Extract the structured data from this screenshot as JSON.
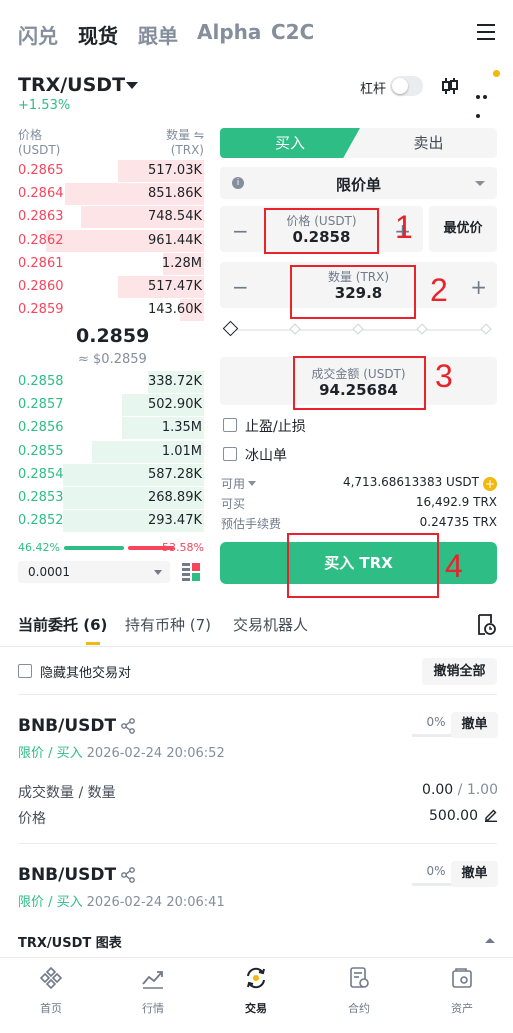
{
  "top_nav": {
    "tabs": [
      "闪兑",
      "现货",
      "跟单",
      "Alpha",
      "C2C"
    ],
    "active": "现货"
  },
  "pair": {
    "name": "TRX/USDT",
    "change": "+1.53%",
    "leverage_label": "杠杆"
  },
  "orderbook": {
    "price_header": "价格",
    "price_unit": "(USDT)",
    "qty_header": "数量 ⇋",
    "qty_unit": "(TRX)",
    "asks": [
      {
        "price": "0.2865",
        "qty": "517.03K",
        "depth": 0.46
      },
      {
        "price": "0.2864",
        "qty": "851.86K",
        "depth": 0.75
      },
      {
        "price": "0.2863",
        "qty": "748.54K",
        "depth": 0.66
      },
      {
        "price": "0.2862",
        "qty": "961.44K",
        "depth": 0.85
      },
      {
        "price": "0.2861",
        "qty": "1.28M",
        "depth": 0.22
      },
      {
        "price": "0.2860",
        "qty": "517.47K",
        "depth": 0.46
      },
      {
        "price": "0.2859",
        "qty": "143.60K",
        "depth": 0.13
      }
    ],
    "mid_price": "0.2859",
    "mid_fiat": "≈ $0.2859",
    "bids": [
      {
        "price": "0.2858",
        "qty": "338.72K",
        "depth": 0.3
      },
      {
        "price": "0.2857",
        "qty": "502.90K",
        "depth": 0.44
      },
      {
        "price": "0.2856",
        "qty": "1.35M",
        "depth": 0.44
      },
      {
        "price": "0.2855",
        "qty": "1.01M",
        "depth": 0.6
      },
      {
        "price": "0.2854",
        "qty": "587.28K",
        "depth": 0.76
      },
      {
        "price": "0.2853",
        "qty": "268.89K",
        "depth": 0.76
      },
      {
        "price": "0.2852",
        "qty": "293.47K",
        "depth": 0.76
      }
    ],
    "buy_ratio": "46.42%",
    "sell_ratio": "53.58%",
    "precision": "0.0001"
  },
  "trade_form": {
    "buy_tab": "买入",
    "sell_tab": "卖出",
    "order_type": "限价单",
    "price_label": "价格 (USDT)",
    "price_value": "0.2858",
    "best_price_btn": "最优价",
    "qty_label": "数量 (TRX)",
    "qty_value": "329.8",
    "total_label": "成交金额 (USDT)",
    "total_value": "94.25684",
    "tpsl_label": "止盈/止损",
    "iceberg_label": "冰山单",
    "available_label": "可用",
    "available_value": "4,713.68613383 USDT",
    "can_buy_label": "可买",
    "can_buy_value": "16,492.9 TRX",
    "fee_label": "预估手续费",
    "fee_value": "0.24735 TRX",
    "submit_label": "买入 TRX"
  },
  "annotations": {
    "marks": [
      "1",
      "2",
      "3",
      "4"
    ],
    "color": "#e8232b"
  },
  "orders": {
    "tabs": [
      "当前委托 (6)",
      "持有币种 (7)",
      "交易机器人"
    ],
    "hide_others_label": "隐藏其他交易对",
    "cancel_all_label": "撤销全部",
    "items": [
      {
        "symbol": "BNB/USDT",
        "type": "限价 / 买入",
        "time": "2026-02-24 20:06:52",
        "fill_pct": "0%",
        "cancel_label": "撤单",
        "qty_label": "成交数量 / 数量",
        "qty_filled": "0.00",
        "qty_sep": " / ",
        "qty_total": "1.00",
        "price_label": "价格",
        "price_value": "500.00"
      },
      {
        "symbol": "BNB/USDT",
        "type": "限价 / 买入",
        "time": "2026-02-24 20:06:41",
        "fill_pct": "0%",
        "cancel_label": "撤单"
      }
    ]
  },
  "chart_toggle_label": "TRX/USDT 图表",
  "bottom_nav": [
    {
      "label": "首页",
      "icon": "home-icon"
    },
    {
      "label": "行情",
      "icon": "markets-icon"
    },
    {
      "label": "交易",
      "icon": "trade-icon"
    },
    {
      "label": "合约",
      "icon": "futures-icon"
    },
    {
      "label": "资产",
      "icon": "assets-icon"
    }
  ],
  "colors": {
    "green": "#2ebd85",
    "red": "#f6465d",
    "yellow": "#f0b90b",
    "text": "#1e2329"
  }
}
